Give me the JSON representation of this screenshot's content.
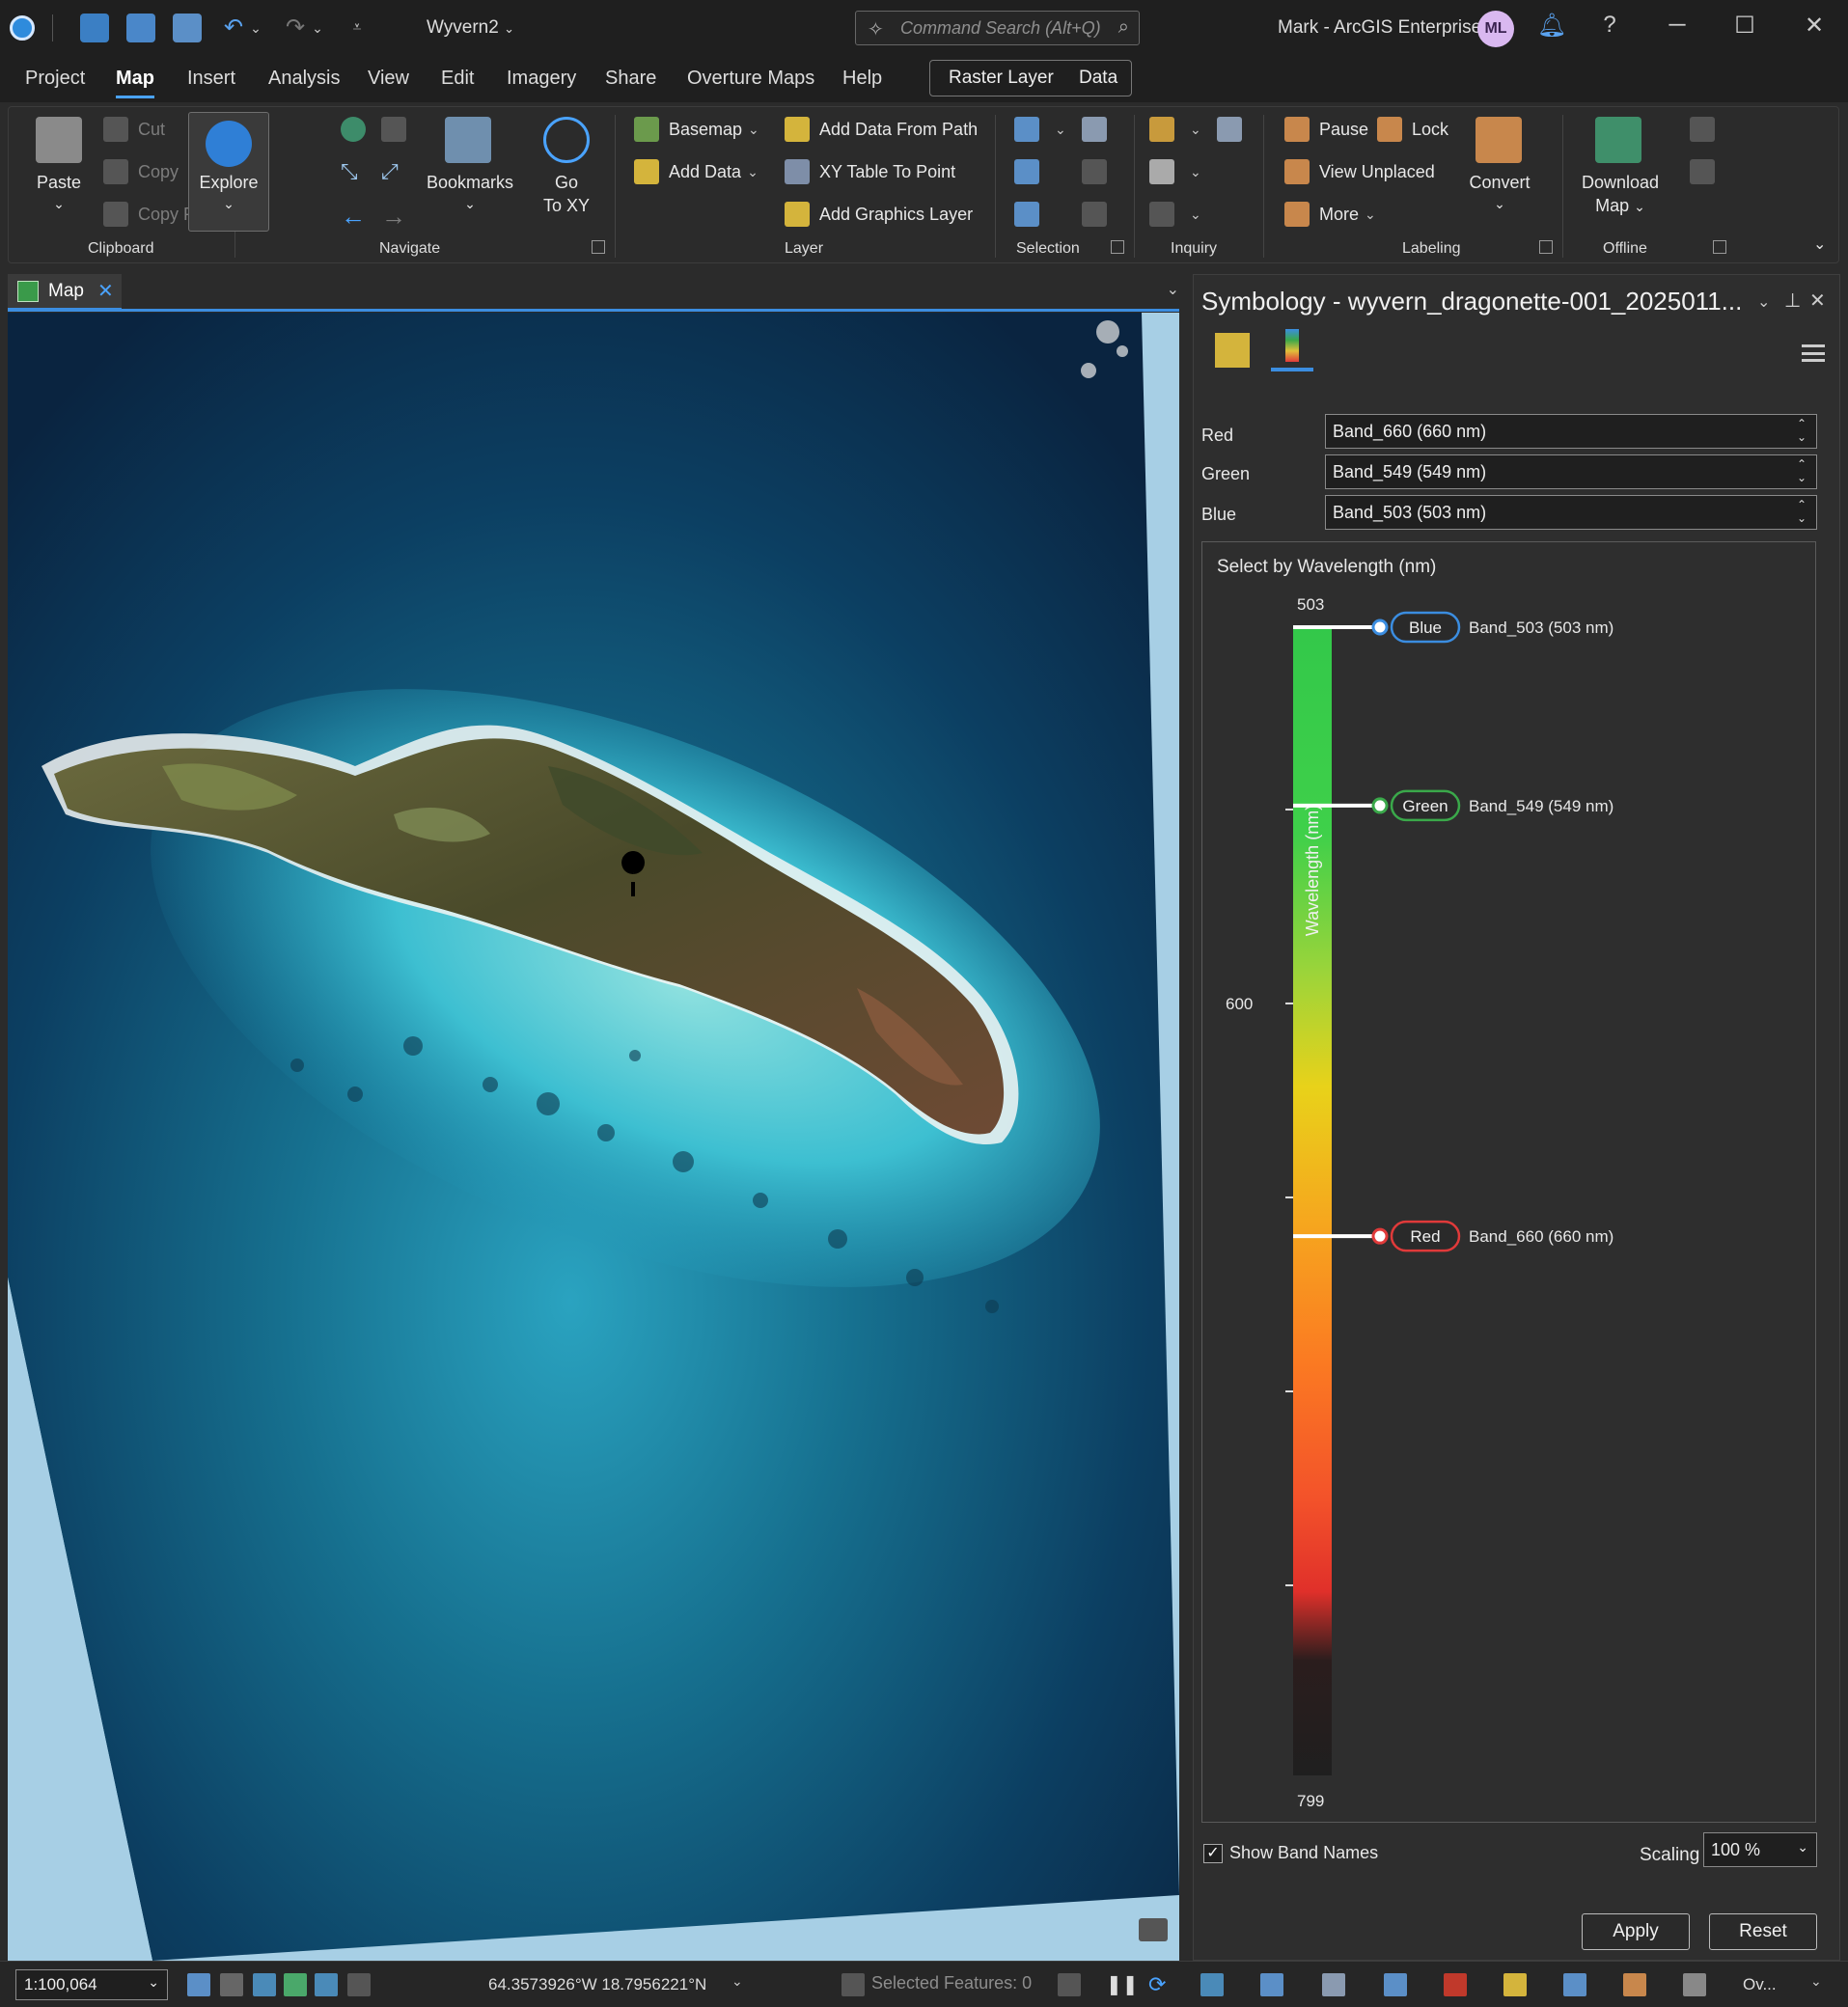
{
  "titlebar": {
    "project_title": "Wyvern2",
    "command_search_placeholder": "Command Search (Alt+Q)",
    "user": "Mark - ArcGIS Enterprise",
    "avatar_initials": "ML",
    "help": "?"
  },
  "tabs": [
    "Project",
    "Map",
    "Insert",
    "Analysis",
    "View",
    "Edit",
    "Imagery",
    "Share",
    "Overture Maps",
    "Help"
  ],
  "active_tab": "Map",
  "contextual_tabs": [
    "Raster Layer",
    "Data"
  ],
  "ribbon": {
    "clipboard": {
      "label": "Clipboard",
      "paste": "Paste",
      "cut": "Cut",
      "copy": "Copy",
      "copy_path": "Copy Path"
    },
    "navigate": {
      "label": "Navigate",
      "explore": "Explore",
      "bookmarks": "Bookmarks",
      "go_to_xy_1": "Go",
      "go_to_xy_2": "To XY"
    },
    "layer": {
      "label": "Layer",
      "basemap": "Basemap",
      "add_data": "Add Data",
      "add_data_from_path": "Add Data From Path",
      "xy_table_to_point": "XY Table To Point",
      "add_graphics_layer": "Add Graphics Layer"
    },
    "selection": {
      "label": "Selection"
    },
    "inquiry": {
      "label": "Inquiry"
    },
    "labeling": {
      "label": "Labeling",
      "pause": "Pause",
      "lock": "Lock",
      "view_unplaced": "View Unplaced",
      "more": "More",
      "convert": "Convert"
    },
    "offline": {
      "label": "Offline",
      "download_map_1": "Download",
      "download_map_2": "Map"
    }
  },
  "map_tab": {
    "label": "Map"
  },
  "symbology": {
    "title": "Symbology - wyvern_dragonette-001_2025011...",
    "bands": [
      {
        "label": "Red",
        "value": "Band_660 (660 nm)"
      },
      {
        "label": "Green",
        "value": "Band_549 (549 nm)"
      },
      {
        "label": "Blue",
        "value": "Band_503 (503 nm)"
      }
    ],
    "wavelength_panel": {
      "title": "Select by Wavelength (nm)",
      "axis_label": "Wavelength (nm)",
      "min": 503,
      "mid_tick_label": "600",
      "max": 799,
      "min_label": "503",
      "max_label": "799",
      "markers": [
        {
          "channel": "Blue",
          "wavelength": 503,
          "band": "Band_503 (503 nm)",
          "color": "#3b8de0"
        },
        {
          "channel": "Green",
          "wavelength": 549,
          "band": "Band_549 (549 nm)",
          "color": "#3aa84a"
        },
        {
          "channel": "Red",
          "wavelength": 660,
          "band": "Band_660 (660 nm)",
          "color": "#e03a3a"
        }
      ]
    },
    "show_band_names": "Show Band Names",
    "show_band_names_checked": true,
    "scaling_label": "Scaling",
    "scaling_value": "100 %",
    "apply": "Apply",
    "reset": "Reset"
  },
  "statusbar": {
    "scale": "1:100,064",
    "coordinates": "64.3573926°W 18.7956221°N",
    "selected_features": "Selected Features: 0",
    "overview": "Ov..."
  },
  "colors": {
    "accent": "#3b8de0",
    "background": "#2b2b2b",
    "titlebar": "#1f1f1f"
  }
}
